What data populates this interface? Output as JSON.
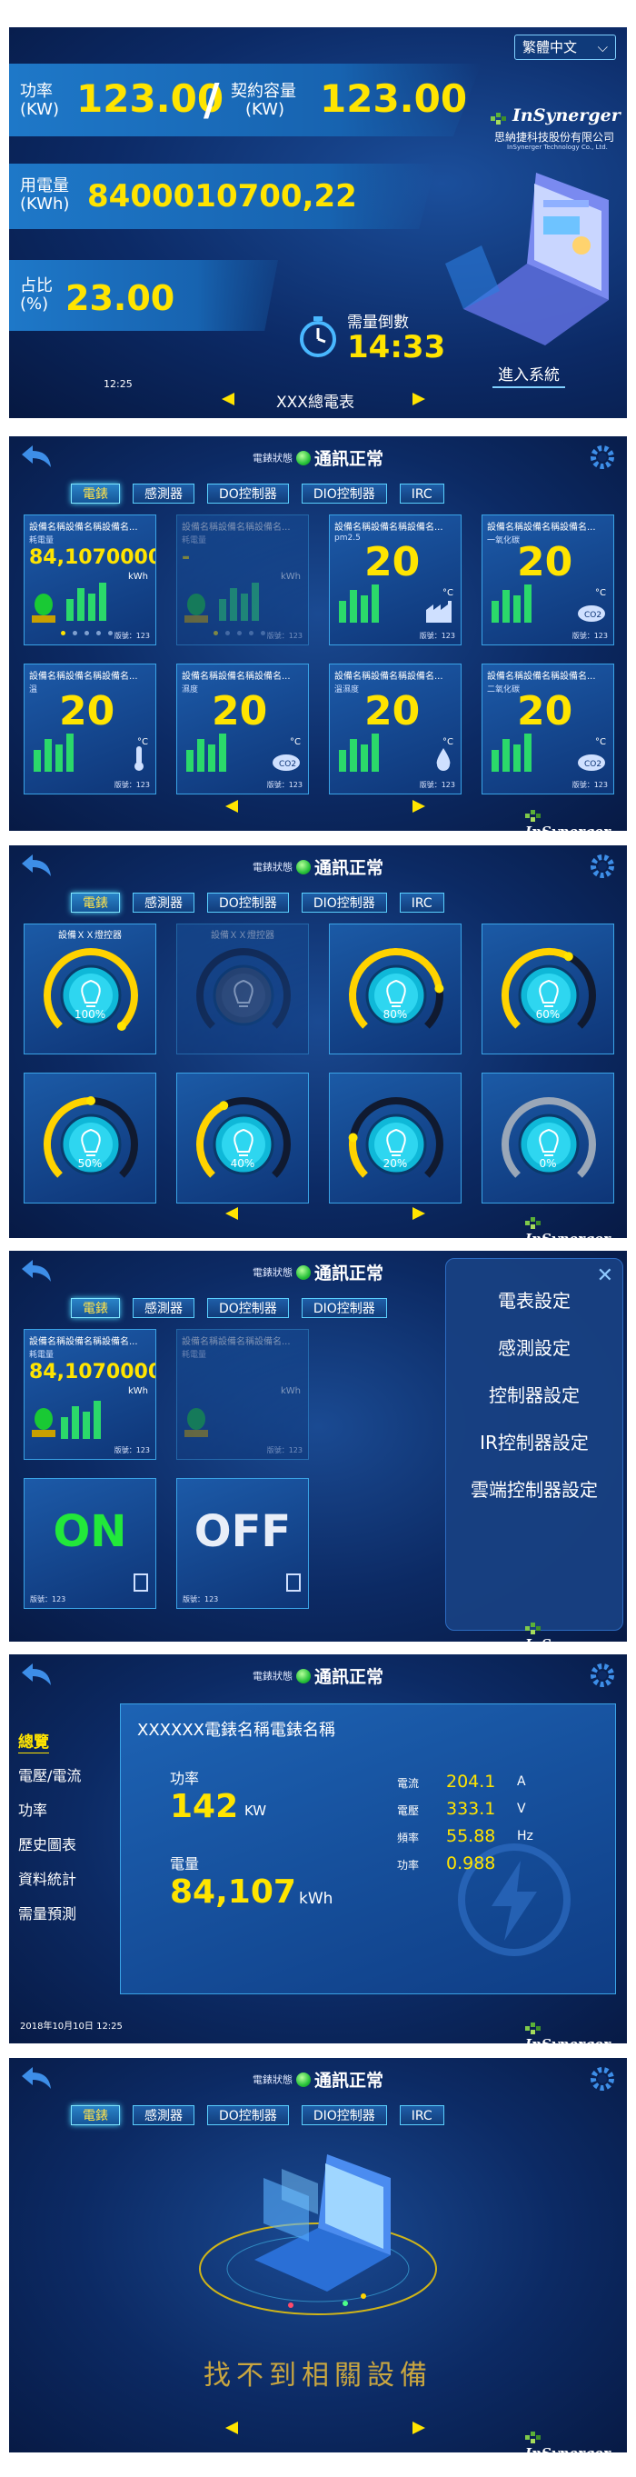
{
  "screen1": {
    "lang": "繁體中文",
    "power_label": "功率",
    "power_unit": "(KW)",
    "power_value": "123.00",
    "contract_label": "契約容量",
    "contract_unit": "(KW)",
    "contract_value": "123.00",
    "energy_label": "用電量",
    "energy_unit": "(KWh)",
    "energy_value": "8400010700,22",
    "ratio_label": "占比",
    "ratio_unit": "(%)",
    "ratio_value": "23.00",
    "countdown_label": "需量倒數",
    "countdown_value": "14:33",
    "time": "12:25",
    "meter_name": "XXX總電表",
    "enter_label": "進入系統",
    "company_name": "思納捷科技股份有限公司",
    "company_en": "InSynerger Technology Co., Ltd."
  },
  "logo": {
    "text": "InSynerger"
  },
  "header": {
    "status_label": "電錶狀態",
    "status_value": "通訊正常"
  },
  "tabs": [
    "電錶",
    "感測器",
    "DO控制器",
    "DIO控制器",
    "IRC"
  ],
  "screen2": {
    "cards": [
      {
        "title": "設備名稱設備名稱設備名...",
        "subtitle": "耗電量",
        "value": "84,1070000",
        "unit": "kWh",
        "version": "版號：123",
        "icon": "siren-icon",
        "dim": false
      },
      {
        "title": "設備名稱設備名稱設備名...",
        "subtitle": "耗電量",
        "value": "-",
        "unit": "kWh",
        "version": "版號：123",
        "icon": "siren-icon",
        "dim": true
      },
      {
        "title": "設備名稱設備名稱設備名...",
        "subtitle": "pm2.5",
        "value": "20",
        "unit": "°C",
        "version": "版號：123",
        "icon": "factory-icon",
        "dim": false
      },
      {
        "title": "設備名稱設備名稱設備名...",
        "subtitle": "一氧化碳",
        "value": "20",
        "unit": "°C",
        "version": "版號：123",
        "icon": "co2-cloud-icon",
        "dim": false
      },
      {
        "title": "設備名稱設備名稱設備名...",
        "subtitle": "溫",
        "value": "20",
        "unit": "°C",
        "version": "版號：123",
        "icon": "thermometer-icon",
        "dim": false
      },
      {
        "title": "設備名稱設備名稱設備名...",
        "subtitle": "濕度",
        "value": "20",
        "unit": "°C",
        "version": "版號：123",
        "icon": "co2-cloud-icon",
        "dim": false
      },
      {
        "title": "設備名稱設備名稱設備名...",
        "subtitle": "溫濕度",
        "value": "20",
        "unit": "°C",
        "version": "版號：123",
        "icon": "droplet-icon",
        "dim": false
      },
      {
        "title": "設備名稱設備名稱設備名...",
        "subtitle": "二氧化碳",
        "value": "20",
        "unit": "°C",
        "version": "版號：123",
        "icon": "co2-cloud-icon",
        "dim": false
      }
    ]
  },
  "screen3": {
    "lamps": [
      {
        "title": "設備ＸＸ燈控器",
        "percent": "100%",
        "level": 1.0,
        "dim": false
      },
      {
        "title": "設備ＸＸ燈控器",
        "percent": "",
        "level": 0,
        "dim": true
      },
      {
        "title": "",
        "percent": "80%",
        "level": 0.8,
        "dim": false
      },
      {
        "title": "",
        "percent": "60%",
        "level": 0.6,
        "dim": false
      },
      {
        "title": "",
        "percent": "50%",
        "level": 0.5,
        "dim": false
      },
      {
        "title": "",
        "percent": "40%",
        "level": 0.4,
        "dim": false
      },
      {
        "title": "",
        "percent": "20%",
        "level": 0.2,
        "dim": false
      },
      {
        "title": "",
        "percent": "0%",
        "level": 0,
        "dim": false
      }
    ]
  },
  "screen4": {
    "menu": [
      "電表設定",
      "感測設定",
      "控制器設定",
      "IR控制器設定",
      "雲端控制器設定"
    ],
    "on_label": "ON",
    "off_label": "OFF",
    "card_title": "設備名稱設備名稱設備名...",
    "card_sub": "耗電量",
    "card_value": "84,1070000",
    "card_unit": "kWh",
    "card_version": "版號：123"
  },
  "screen5": {
    "nav": [
      "總覽",
      "電壓/電流",
      "功率",
      "歷史圖表",
      "資料統計",
      "需量預測"
    ],
    "meter_title": "XXXXXX電錶名稱電錶名稱",
    "power_label": "功率",
    "power_value": "142",
    "power_unit": "KW",
    "energy_label": "電量",
    "energy_value": "84,107",
    "energy_unit": "kWh",
    "readings": [
      {
        "label": "電流",
        "value": "204.1",
        "unit": "A"
      },
      {
        "label": "電壓",
        "value": "333.1",
        "unit": "V"
      },
      {
        "label": "頻率",
        "value": "55.88",
        "unit": "Hz"
      },
      {
        "label": "功率",
        "value": "0.988",
        "unit": ""
      }
    ],
    "datetime": "2018年10月10日 12:25"
  },
  "screen6": {
    "empty_message": "找不到相關設備"
  },
  "colors": {
    "accent_yellow": "#ffe400",
    "status_green": "#27c23a",
    "tab_border": "#5ad0ff",
    "on_green": "#22e83a"
  }
}
